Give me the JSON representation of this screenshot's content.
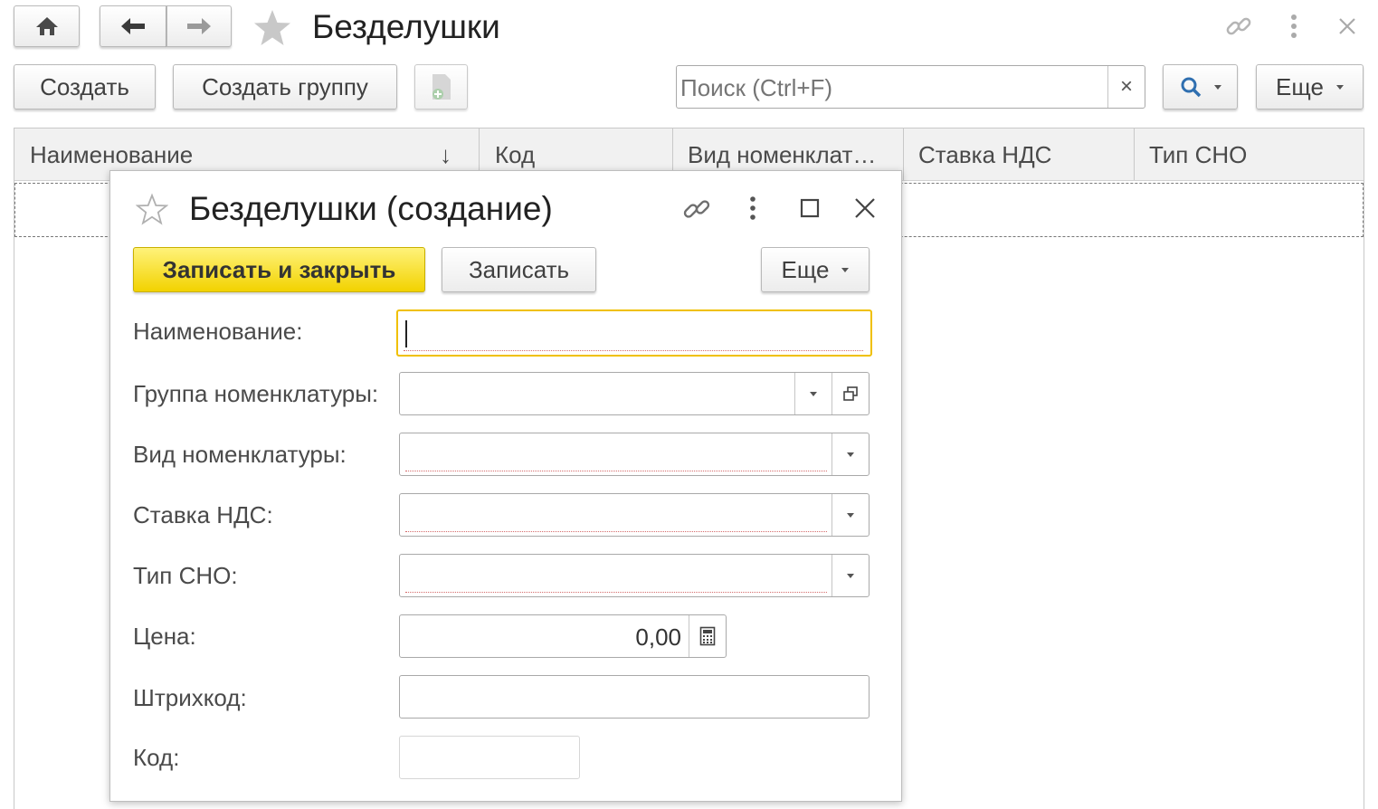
{
  "window": {
    "title": "Безделушки",
    "icons": {
      "home": "home-icon",
      "back": "arrow-left-icon",
      "forward": "arrow-right-icon",
      "favorite": "star-icon",
      "link": "link-icon",
      "menu": "vertical-dots-icon",
      "close": "close-icon"
    }
  },
  "toolbar": {
    "create_label": "Создать",
    "create_group_label": "Создать группу",
    "copy_icon": "document-add-icon",
    "search": {
      "placeholder": "Поиск (Ctrl+F)",
      "value": "",
      "clear": "×"
    },
    "search_icon": "search-icon",
    "more_label": "Еще"
  },
  "table": {
    "columns": [
      "Наименование",
      "Код",
      "Вид номенклат…",
      "Ставка НДС",
      "Тип СНО"
    ],
    "sort_indicator": "↓"
  },
  "dialog": {
    "title": "Безделушки (создание)",
    "icons": {
      "favorite": "star-outline-icon",
      "link": "link-icon",
      "menu": "vertical-dots-icon",
      "maximize": "maximize-icon",
      "close": "close-icon"
    },
    "buttons": {
      "save_close": "Записать и закрыть",
      "save": "Записать",
      "more": "Еще"
    },
    "fields": {
      "name": {
        "label": "Наименование:",
        "value": ""
      },
      "group": {
        "label": "Группа номенклатуры:",
        "value": ""
      },
      "kind": {
        "label": "Вид номенклатуры:",
        "value": ""
      },
      "vat": {
        "label": "Ставка НДС:",
        "value": ""
      },
      "tax": {
        "label": "Тип СНО:",
        "value": ""
      },
      "price": {
        "label": "Цена:",
        "value": "0,00"
      },
      "barcode": {
        "label": "Штрихкод:",
        "value": ""
      },
      "code": {
        "label": "Код:",
        "value": ""
      }
    },
    "colors": {
      "accent_yellow": "#f5d800",
      "focus_border": "#f0c000",
      "required_underline": "#d46a6a"
    }
  }
}
